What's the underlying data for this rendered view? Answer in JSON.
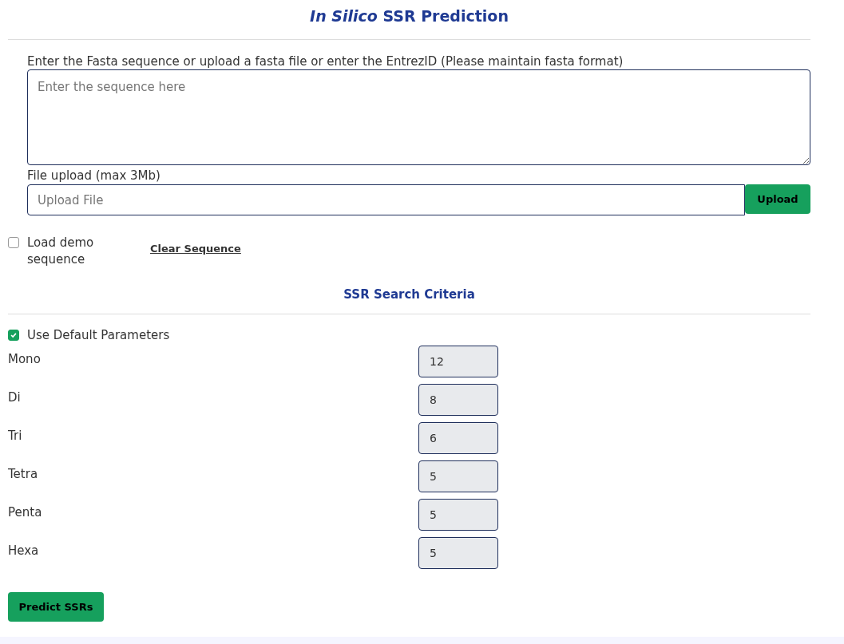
{
  "title": "*In Silico* SSR Prediction",
  "sequence": {
    "label": "Enter the Fasta sequence or upload a fasta file or enter the EntrezID (Please maintain fasta format)",
    "placeholder": "Enter the sequence here"
  },
  "upload": {
    "label": "File upload (max 3Mb)",
    "placeholder": "Upload File",
    "button": "Upload"
  },
  "demo": {
    "label": "Load demo sequence",
    "checked": false
  },
  "clear_link": "Clear Sequence",
  "criteria": {
    "heading": "SSR Search Criteria",
    "use_default": {
      "label": "Use Default Parameters",
      "checked": true
    },
    "params": [
      {
        "label": "Mono",
        "value": "12"
      },
      {
        "label": "Di",
        "value": "8"
      },
      {
        "label": "Tri",
        "value": "6"
      },
      {
        "label": "Tetra",
        "value": "5"
      },
      {
        "label": "Penta",
        "value": "5"
      },
      {
        "label": "Hexa",
        "value": "5"
      }
    ]
  },
  "submit": "Predict SSRs"
}
